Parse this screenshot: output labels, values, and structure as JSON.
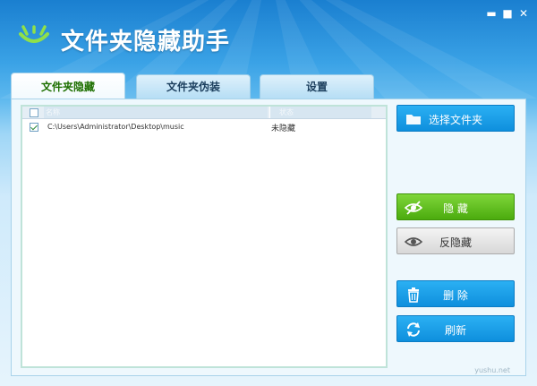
{
  "app": {
    "title": "文件夹隐藏助手",
    "window_controls": {
      "minimize": "▬",
      "maximize": "■",
      "close": "✕"
    }
  },
  "tabs": [
    {
      "label": "文件夹隐藏",
      "active": true
    },
    {
      "label": "文件夹伪装",
      "active": false
    },
    {
      "label": "设置",
      "active": false
    }
  ],
  "list": {
    "columns": {
      "name": "名称",
      "status": "状态"
    },
    "rows": [
      {
        "path": "C:\\Users\\Administrator\\Desktop\\music",
        "status": "未隐藏",
        "checked": true
      }
    ]
  },
  "buttons": {
    "select_folder": "选择文件夹",
    "hide": "隐 藏",
    "unhide": "反隐藏",
    "delete": "删 除",
    "refresh": "刷新"
  },
  "watermark": "yushu.net",
  "colors": {
    "accent_blue": "#0e8fdd",
    "accent_green": "#4bab0e",
    "header_blue": "#1a7fd0"
  }
}
